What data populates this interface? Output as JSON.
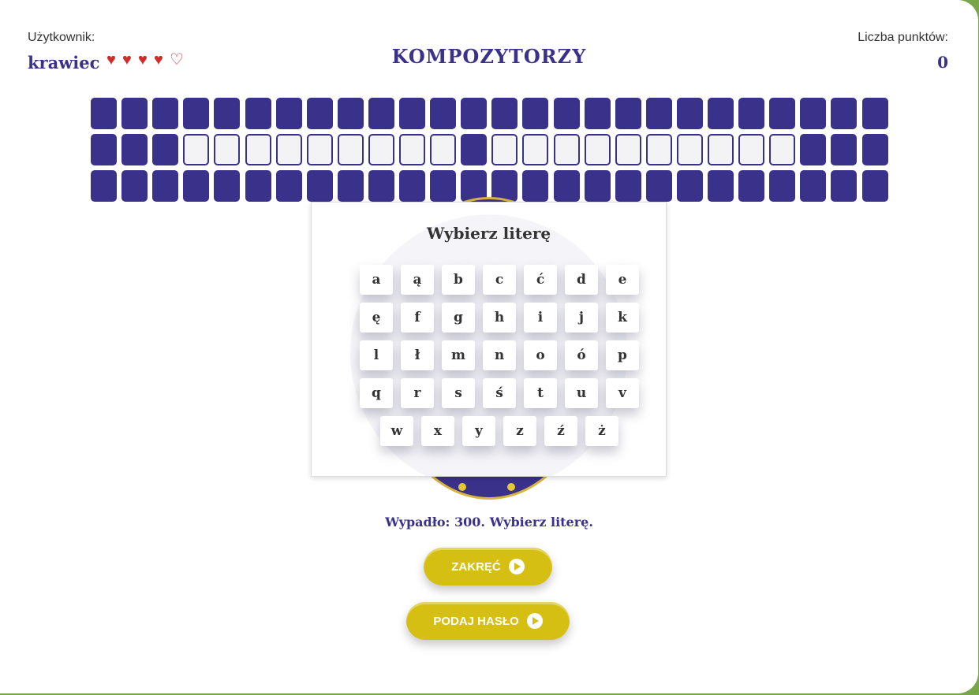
{
  "header": {
    "user_label": "Użytkownik:",
    "user_name": "krawiec",
    "lives": {
      "full": 4,
      "total": 5
    },
    "category": "KOMPOZYTORZY",
    "score_label": "Liczba punktów:",
    "score": "0"
  },
  "board": {
    "rows": 3,
    "cols": 26,
    "row_pattern": [
      "XXXXXXXXXXXXXXXXXXXXXXXXXX",
      "XXX_________X__________XXX",
      "XXXXXXXXXXXXXXXXXXXXXXXXXX"
    ]
  },
  "letter_panel": {
    "title": "Wybierz literę",
    "rows": [
      [
        "a",
        "ą",
        "b",
        "c",
        "ć",
        "d",
        "e"
      ],
      [
        "ę",
        "f",
        "g",
        "h",
        "i",
        "j",
        "k"
      ],
      [
        "l",
        "ł",
        "m",
        "n",
        "o",
        "ó",
        "p"
      ],
      [
        "q",
        "r",
        "s",
        "ś",
        "t",
        "u",
        "v"
      ],
      [
        "w",
        "x",
        "y",
        "z",
        "ź",
        "ż"
      ]
    ]
  },
  "status": "Wypadło: 300. Wybierz literę.",
  "buttons": {
    "spin": "ZAKRĘĆ",
    "guess": "PODAJ HASŁO"
  },
  "colors": {
    "primary": "#3a318a",
    "accent": "#d5bf12",
    "heart": "#d22b2b",
    "frame": "#7aa64a"
  }
}
